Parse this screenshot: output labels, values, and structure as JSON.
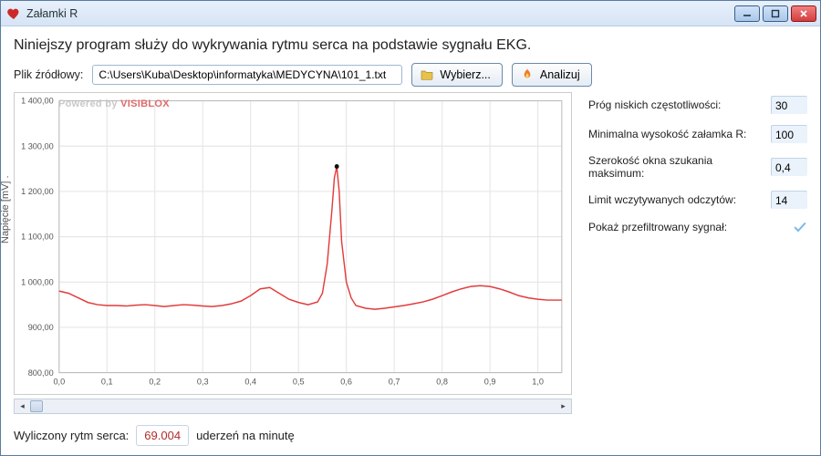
{
  "window": {
    "title": "Załamki R"
  },
  "header": {
    "desc": "Niniejszy program służy do wykrywania rytmu serca na podstawie sygnału EKG.",
    "file_label": "Plik źródłowy:",
    "file_value": "C:\\Users\\Kuba\\Desktop\\informatyka\\MEDYCYNA\\101_1.txt",
    "browse_label": "Wybierz...",
    "analyze_label": "Analizuj"
  },
  "params": {
    "low_freq_label": "Próg niskich częstotliwości:",
    "low_freq_value": "30",
    "min_r_label": "Minimalna wysokość załamka R:",
    "min_r_value": "100",
    "window_label": "Szerokość okna szukania maksimum:",
    "window_value": "0,4",
    "limit_label": "Limit wczytywanych odczytów:",
    "limit_value": "14",
    "show_filtered_label": "Pokaż przefiltrowany sygnał:",
    "show_filtered_checked": true
  },
  "result": {
    "prefix": "Wyliczony rytm serca:",
    "value": "69.004",
    "suffix": "uderzeń na minutę"
  },
  "chart": {
    "ylabel": "Napięcie [mV] .",
    "powered_prefix": "Powered by ",
    "powered_brand": "VISIBLOX",
    "x_ticks": [
      "0,0",
      "0,1",
      "0,2",
      "0,3",
      "0,4",
      "0,5",
      "0,6",
      "0,7",
      "0,8",
      "0,9",
      "1,0"
    ],
    "y_ticks": [
      "800,00",
      "900,00",
      "1 000,00",
      "1 100,00",
      "1 200,00",
      "1 300,00",
      "1 400,00"
    ]
  },
  "chart_data": {
    "type": "line",
    "title": "",
    "xlabel": "",
    "ylabel": "Napięcie [mV]",
    "xlim": [
      0.0,
      1.05
    ],
    "ylim": [
      800,
      1400
    ],
    "x": [
      0.0,
      0.02,
      0.04,
      0.06,
      0.08,
      0.1,
      0.12,
      0.14,
      0.16,
      0.18,
      0.2,
      0.22,
      0.24,
      0.26,
      0.28,
      0.3,
      0.32,
      0.34,
      0.36,
      0.38,
      0.4,
      0.42,
      0.44,
      0.46,
      0.48,
      0.5,
      0.52,
      0.54,
      0.55,
      0.56,
      0.57,
      0.575,
      0.58,
      0.585,
      0.59,
      0.6,
      0.61,
      0.62,
      0.64,
      0.66,
      0.68,
      0.7,
      0.72,
      0.74,
      0.76,
      0.78,
      0.8,
      0.82,
      0.84,
      0.86,
      0.88,
      0.9,
      0.92,
      0.94,
      0.96,
      0.98,
      1.0,
      1.02,
      1.05
    ],
    "values": [
      980,
      975,
      965,
      955,
      950,
      948,
      948,
      947,
      949,
      950,
      948,
      946,
      948,
      950,
      949,
      947,
      946,
      948,
      952,
      958,
      970,
      985,
      988,
      975,
      962,
      955,
      950,
      956,
      975,
      1040,
      1160,
      1230,
      1255,
      1200,
      1090,
      1000,
      965,
      948,
      942,
      940,
      942,
      945,
      948,
      952,
      956,
      962,
      970,
      978,
      985,
      990,
      992,
      990,
      985,
      978,
      970,
      965,
      962,
      960,
      960
    ],
    "markers": [
      {
        "x": 0.58,
        "y": 1255
      }
    ]
  }
}
